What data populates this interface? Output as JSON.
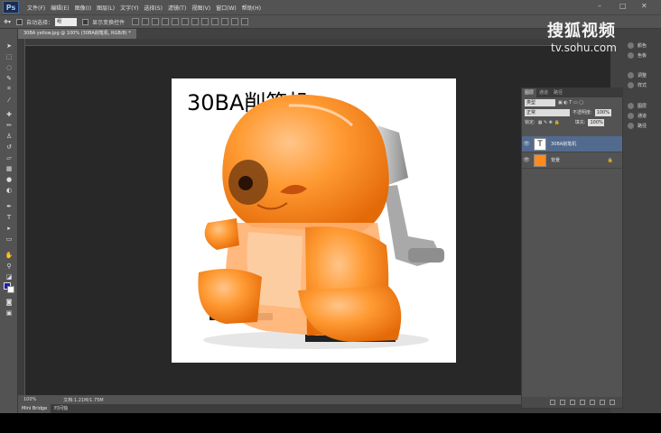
{
  "app": {
    "logo_text": "Ps",
    "menus": [
      "文件(F)",
      "编辑(E)",
      "图像(I)",
      "图层(L)",
      "文字(Y)",
      "选择(S)",
      "滤镜(T)",
      "视图(V)",
      "窗口(W)",
      "帮助(H)"
    ]
  },
  "options_bar": {
    "auto_select_label": "自动选择：",
    "auto_select_value": "组",
    "show_transform_label": "显示变换控件"
  },
  "document": {
    "tab_title": "30BA yellow.jpg @ 100% (30BA削笔机, RGB/8) *",
    "image_text": "30BA削笔机"
  },
  "status": {
    "zoom": "100%",
    "doc_size": "文档:1.21M/1.75M"
  },
  "bottom_tabs": [
    "Mini Bridge",
    "时间轴"
  ],
  "right_dock": {
    "group1": [
      "颜色",
      "色板"
    ],
    "group2": [
      "调整",
      "样式"
    ],
    "group3": [
      "图层",
      "通道",
      "路径"
    ]
  },
  "layers_panel": {
    "tabs": [
      "图层",
      "通道",
      "路径"
    ],
    "filter_kind": "类型",
    "blend_mode": "正常",
    "opacity_label": "不透明度:",
    "opacity_value": "100%",
    "lock_label": "锁定:",
    "fill_label": "填充:",
    "fill_value": "100%",
    "layers": [
      {
        "name": "30BA削笔机",
        "type": "text",
        "selected": true
      },
      {
        "name": "背景",
        "type": "image",
        "locked": true,
        "selected": false
      }
    ]
  },
  "watermark": {
    "main": "搜狐视频",
    "sub": "tv.sohu.com"
  },
  "colors": {
    "foreground": "#1a22aa",
    "background": "#ffffff",
    "accent_orange": "#ff8a1e",
    "selection": "#526a8e"
  }
}
